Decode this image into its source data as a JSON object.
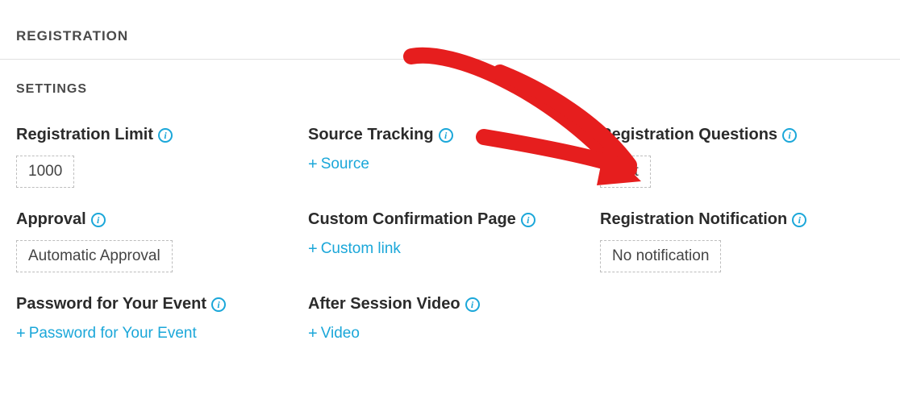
{
  "header": {
    "title": "REGISTRATION"
  },
  "subheader": {
    "title": "SETTINGS"
  },
  "fields": {
    "reg_limit": {
      "label": "Registration Limit",
      "value": "1000"
    },
    "source": {
      "label": "Source Tracking",
      "add": "Source"
    },
    "questions": {
      "label": "Registration Questions",
      "value": "Edit"
    },
    "approval": {
      "label": "Approval",
      "value": "Automatic Approval"
    },
    "confirm": {
      "label": "Custom Confirmation Page",
      "add": "Custom link"
    },
    "notify": {
      "label": "Registration Notification",
      "value": "No notification"
    },
    "password": {
      "label": "Password for Your Event",
      "add": "Password for Your Event"
    },
    "aftervideo": {
      "label": "After Session Video",
      "add": "Video"
    }
  },
  "icons": {
    "info": "i",
    "plus": "+"
  }
}
